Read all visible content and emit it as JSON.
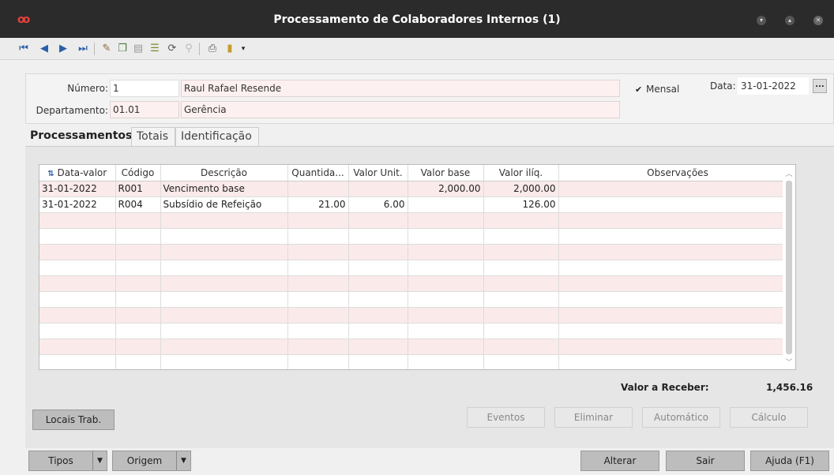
{
  "window": {
    "title": "Processamento de Colaboradores Internos (1)"
  },
  "toolbar": {
    "first_icon": "first-record-icon",
    "prev_icon": "previous-record-icon",
    "next_icon": "next-record-icon",
    "last_icon": "last-record-icon"
  },
  "header": {
    "numero_label": "Número:",
    "numero_value": "1",
    "nome_value": "Raul Rafael Resende",
    "departamento_label": "Departamento:",
    "departamento_value": "01.01",
    "departamento_nome": "Gerência",
    "mensal_check": "✔",
    "mensal_label": "Mensal",
    "data_label": "Data:",
    "data_value": "31-01-2022",
    "data_button": "..."
  },
  "tabs": [
    {
      "label": "Processamentos"
    },
    {
      "label": "Totais"
    },
    {
      "label": "Identificação"
    }
  ],
  "grid": {
    "sort_icon": "sort-az-icon",
    "columns": [
      "Data-valor",
      "Código",
      "Descrição",
      "Quantida...",
      "Valor Unit.",
      "Valor base",
      "Valor ilíq.",
      "Observações"
    ],
    "rows": [
      {
        "data": "31-01-2022",
        "codigo": "R001",
        "descricao": "Vencimento base",
        "quantidade": "",
        "valor_unit": "",
        "valor_base": "2,000.00",
        "valor_iliq": "2,000.00",
        "obs": ""
      },
      {
        "data": "31-01-2022",
        "codigo": "R004",
        "descricao": "Subsídio de Refeição",
        "quantidade": "21.00",
        "valor_unit": "6.00",
        "valor_base": "",
        "valor_iliq": "126.00",
        "obs": ""
      }
    ]
  },
  "totals": {
    "valor_receber_label": "Valor a Receber:",
    "valor_receber_value": "1,456.16"
  },
  "buttons": {
    "locais": "Locais Trab.",
    "eventos": "Eventos",
    "eliminar": "Eliminar",
    "automatico": "Automático",
    "calculo": "Cálculo"
  },
  "footer": {
    "tipos": "Tipos",
    "origem": "Origem",
    "alterar": "Alterar",
    "sair": "Sair",
    "ajuda": "Ajuda (F1)"
  }
}
